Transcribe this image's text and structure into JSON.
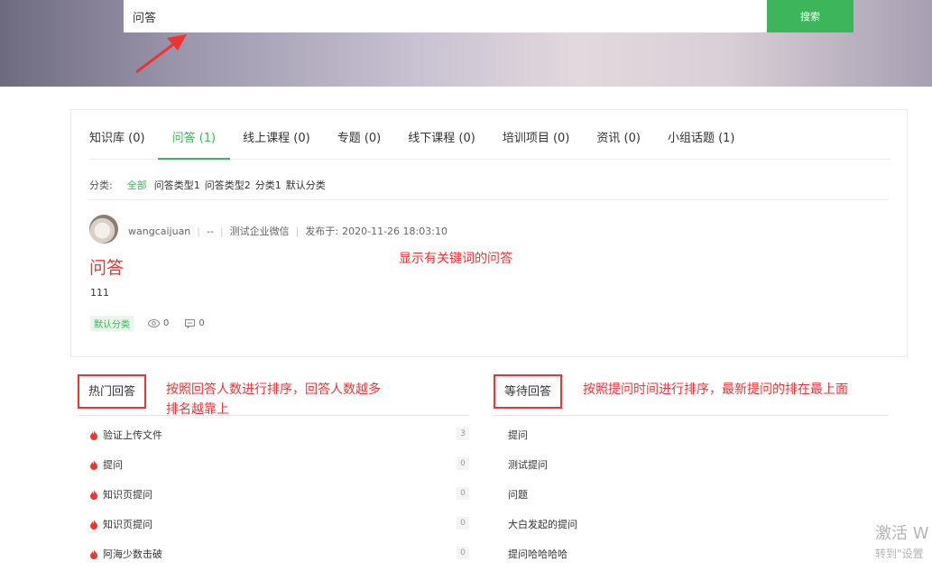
{
  "search": {
    "value": "问答",
    "button_label": "搜索"
  },
  "tabs": [
    {
      "label": "知识库 (0)"
    },
    {
      "label": "问答 (1)"
    },
    {
      "label": "线上课程 (0)"
    },
    {
      "label": "专题 (0)"
    },
    {
      "label": "线下课程 (0)"
    },
    {
      "label": "培训项目 (0)"
    },
    {
      "label": "资讯 (0)"
    },
    {
      "label": "小组话题 (1)"
    }
  ],
  "categories": {
    "label": "分类:",
    "items": [
      "全部",
      "问答类型1",
      "问答类型2",
      "分类1",
      "默认分类"
    ]
  },
  "question": {
    "author": "wangcaijuan",
    "dept": "--",
    "org": "测试企业微信",
    "published_label": "发布于:",
    "published": "2020-11-26 18:03:10",
    "title": "问答",
    "body": "111",
    "tag": "默认分类",
    "views": "0",
    "comments": "0"
  },
  "annotations": {
    "result_note": "显示有关键词的问答",
    "hot_note_line1": "按照回答人数进行排序，回答人数越多",
    "hot_note_line2": "排名越靠上",
    "wait_note": "按照提问时间进行排序，最新提问的排在最上面"
  },
  "hot": {
    "title": "热门回答",
    "items": [
      {
        "label": "验证上传文件",
        "count": "3"
      },
      {
        "label": "提问",
        "count": "0"
      },
      {
        "label": "知识页提问",
        "count": "0"
      },
      {
        "label": "知识页提问",
        "count": "0"
      },
      {
        "label": "阿海少数击破",
        "count": "0"
      }
    ]
  },
  "waiting": {
    "title": "等待回答",
    "items": [
      {
        "label": "提问"
      },
      {
        "label": "测试提问"
      },
      {
        "label": "问题"
      },
      {
        "label": "大白发起的提问"
      },
      {
        "label": "提问哈哈哈哈"
      }
    ]
  },
  "watermark": {
    "line1": "激活 W",
    "line2": "转到\"设置"
  },
  "colors": {
    "accent": "#3cb55b",
    "annotation": "#ee3333"
  }
}
